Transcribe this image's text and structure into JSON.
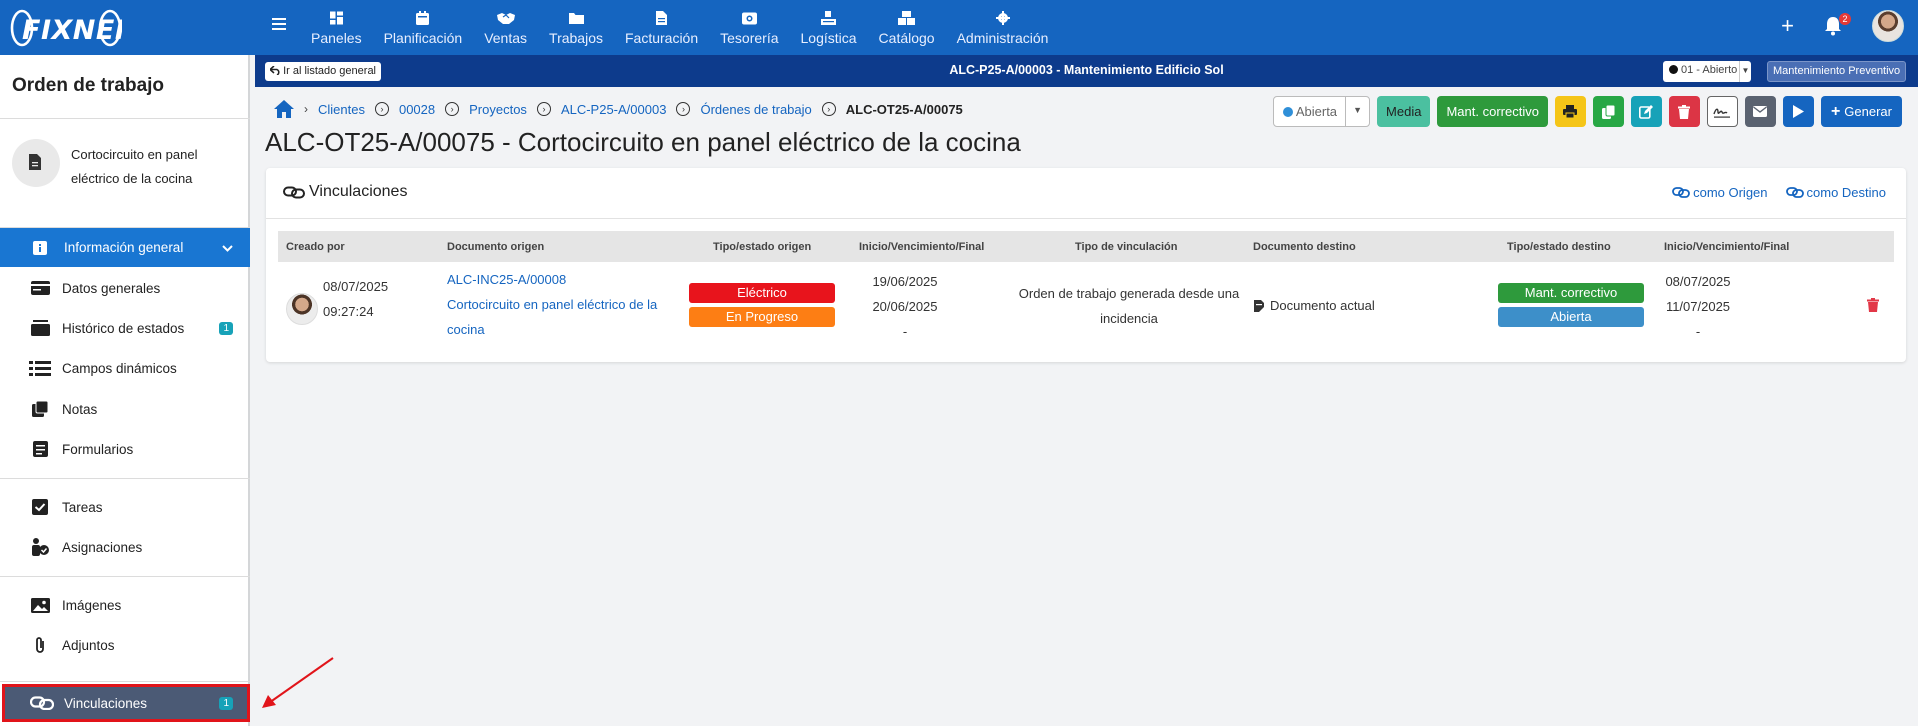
{
  "brand": {
    "logo_text": "FIXNER"
  },
  "topnav": [
    {
      "label": "Paneles",
      "icon": "dashboard-icon"
    },
    {
      "label": "Planificación",
      "icon": "calendar-icon"
    },
    {
      "label": "Ventas",
      "icon": "handshake-icon"
    },
    {
      "label": "Trabajos",
      "icon": "folder-icon"
    },
    {
      "label": "Facturación",
      "icon": "invoice-icon"
    },
    {
      "label": "Tesorería",
      "icon": "wallet-icon"
    },
    {
      "label": "Logística",
      "icon": "truck-icon"
    },
    {
      "label": "Catálogo",
      "icon": "boxes-icon"
    },
    {
      "label": "Administración",
      "icon": "gear-icon"
    }
  ],
  "notifications": {
    "count": "2"
  },
  "subbar": {
    "back_label": "Ir al listado general",
    "title": "ALC-P25-A/00003 - Mantenimiento Edificio Sol",
    "state": "01 - Abierto",
    "type": "Mantenimiento Preventivo"
  },
  "sidebar": {
    "title": "Orden de trabajo",
    "doc_name": "Cortocircuito en panel eléctrico de la cocina",
    "section": "Información general",
    "items": [
      {
        "label": "Datos generales",
        "icon": "id-card-icon"
      },
      {
        "label": "Histórico de estados",
        "icon": "history-icon",
        "count": "1"
      },
      {
        "label": "Campos dinámicos",
        "icon": "list-icon"
      },
      {
        "label": "Notas",
        "icon": "notes-icon"
      },
      {
        "label": "Formularios",
        "icon": "form-icon"
      },
      {
        "label": "Tareas",
        "icon": "check-square-icon"
      },
      {
        "label": "Asignaciones",
        "icon": "user-check-icon"
      },
      {
        "label": "Imágenes",
        "icon": "image-icon"
      },
      {
        "label": "Adjuntos",
        "icon": "paperclip-icon"
      },
      {
        "label": "Vinculaciones",
        "icon": "link-icon",
        "count": "1"
      }
    ]
  },
  "breadcrumb": [
    "Clientes",
    "00028",
    "Proyectos",
    "ALC-P25-A/00003",
    "Órdenes de trabajo",
    "ALC-OT25-A/00075"
  ],
  "page_title": "ALC-OT25-A/00075 - Cortocircuito en panel eléctrico de la cocina",
  "actions": {
    "status": "Abierta",
    "priority": "Media",
    "type": "Mant. correctivo",
    "generate": "Generar"
  },
  "card": {
    "title": "Vinculaciones",
    "link_origin": "como Origen",
    "link_dest": "como Destino",
    "columns": [
      "Creado por",
      "Documento origen",
      "Tipo/estado origen",
      "Inicio/Vencimiento/Final",
      "Tipo de vinculación",
      "Documento destino",
      "Tipo/estado destino",
      "Inicio/Vencimiento/Final"
    ],
    "row": {
      "date": "08/07/2025",
      "time": "09:27:24",
      "origin_code": "ALC-INC25-A/00008",
      "origin_desc": "Cortocircuito en panel eléctrico de la cocina",
      "origin_type": "Eléctrico",
      "origin_state": "En Progreso",
      "origin_start": "19/06/2025",
      "origin_due": "20/06/2025",
      "origin_end": "-",
      "link_type": "Orden de trabajo generada desde una incidencia",
      "dest_doc": "Documento actual",
      "dest_type": "Mant. correctivo",
      "dest_state": "Abierta",
      "dest_start": "08/07/2025",
      "dest_due": "11/07/2025",
      "dest_end": "-"
    }
  },
  "colors": {
    "topbar": "#1565c0",
    "subbar": "#0d3b8c",
    "pill_red": "#e8141c",
    "pill_orange": "#fd7e14",
    "pill_green": "#2e9a3c",
    "pill_blue": "#3d8fc9"
  }
}
